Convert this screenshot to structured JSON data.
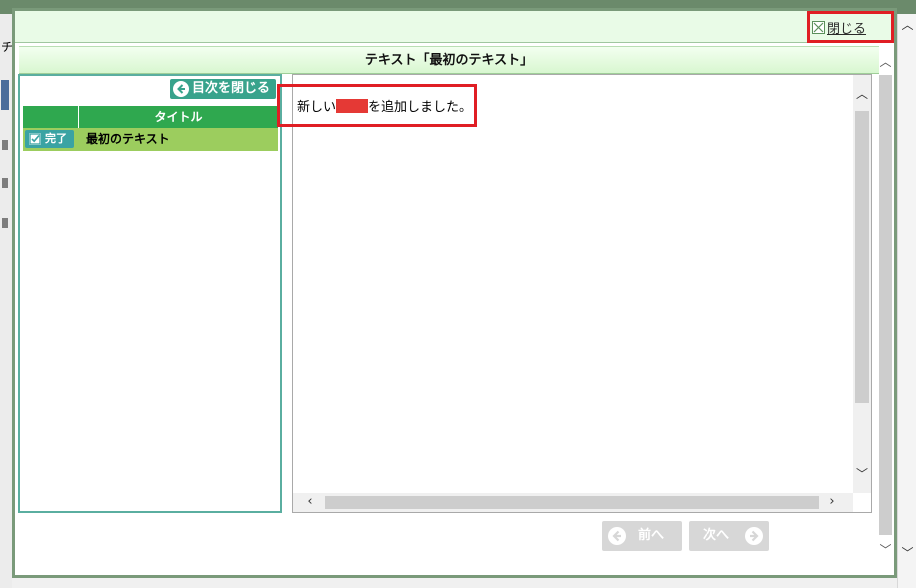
{
  "background": {
    "left_char": "チ"
  },
  "dialog": {
    "close_label": "閉じる",
    "title": "テキスト「最初のテキスト」"
  },
  "toc": {
    "close_button_label": "目次を閉じる",
    "column_header": "タイトル",
    "rows": [
      {
        "status": "完了",
        "title": "最初のテキスト"
      }
    ]
  },
  "content": {
    "text_before": "新しい",
    "text_after": "を追加しました。"
  },
  "nav": {
    "prev_label": "前へ",
    "next_label": "次へ"
  },
  "colors": {
    "accent_green": "#2fa84f",
    "row_highlight": "#9ccd5e",
    "annotation_red": "#e01e24",
    "teal": "#38a38c"
  },
  "icons": {
    "close": "close-x-icon",
    "toc_back": "arrow-left-circle-icon",
    "status": "check-square-icon",
    "prev": "arrow-left-circle-icon",
    "next": "arrow-right-circle-icon"
  }
}
